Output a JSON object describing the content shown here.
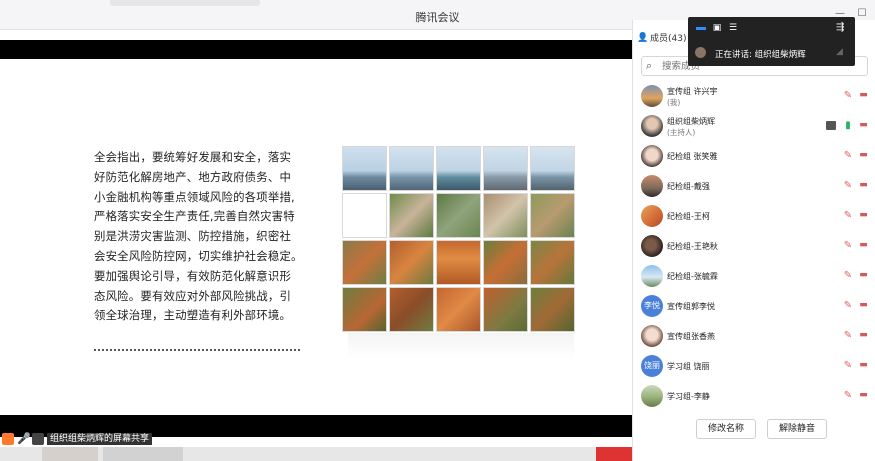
{
  "window": {
    "title": "腾讯会议"
  },
  "slide": {
    "lines": [
      "全会指出，要统筹好发展和安全，落实",
      "好防范化解房地产、地方政府债务、中",
      "小金融机构等重点领域风险的各项举措,",
      "严格落实安全生产责任,完善自然灾害特",
      "别是洪涝灾害监测、防控措施，织密社",
      "会安全风险防控网，切实维护社会稳定。",
      "要加强舆论引导，有效防范化解意识形",
      "态风险。要有效应对外部风险挑战，引",
      "领全球治理，主动塑造有利外部环境。"
    ]
  },
  "status_bar": {
    "label": "组织组柴炳辉的屏幕共享"
  },
  "overlay": {
    "speaking_label": "正在讲话:  组织组柴炳辉"
  },
  "members_panel": {
    "title": "成员(43)",
    "search_placeholder": "搜索成员",
    "members": [
      {
        "name": "宣传组 许兴宇",
        "sub": "(我)",
        "avatar": "photo-sunset",
        "mic": "muted",
        "cam": "off"
      },
      {
        "name": "组织组柴炳辉",
        "sub": "(主持人)",
        "avatar": "photo-man",
        "mic": "on",
        "cam": "off",
        "sharing": true
      },
      {
        "name": "纪检组  张笑雅",
        "sub": "",
        "avatar": "photo-woman",
        "mic": "muted",
        "cam": "off"
      },
      {
        "name": "纪检组-戴强",
        "sub": "",
        "avatar": "photo-landscape",
        "mic": "muted",
        "cam": "off"
      },
      {
        "name": "纪检组-王柯",
        "sub": "",
        "avatar": "photo-orange",
        "mic": "muted",
        "cam": "off"
      },
      {
        "name": "纪检组-王艳秋",
        "sub": "",
        "avatar": "photo-dark",
        "mic": "muted",
        "cam": "off"
      },
      {
        "name": "纪检组-张毓霖",
        "sub": "",
        "avatar": "photo-sky",
        "mic": "muted",
        "cam": "off"
      },
      {
        "name": "宣传组郭李悦",
        "sub": "",
        "avatar_text": "李悦",
        "mic": "muted",
        "cam": "off"
      },
      {
        "name": "宣传组张香燕",
        "sub": "",
        "avatar": "photo-girl",
        "mic": "muted",
        "cam": "off"
      },
      {
        "name": "学习组 饶丽",
        "sub": "",
        "avatar_text": "饶丽",
        "mic": "muted",
        "cam": "off"
      },
      {
        "name": "学习组-李静",
        "sub": "",
        "avatar": "photo-field",
        "mic": "muted",
        "cam": "off"
      }
    ],
    "rename_button": "修改名称",
    "unmute_button": "解除静音"
  }
}
